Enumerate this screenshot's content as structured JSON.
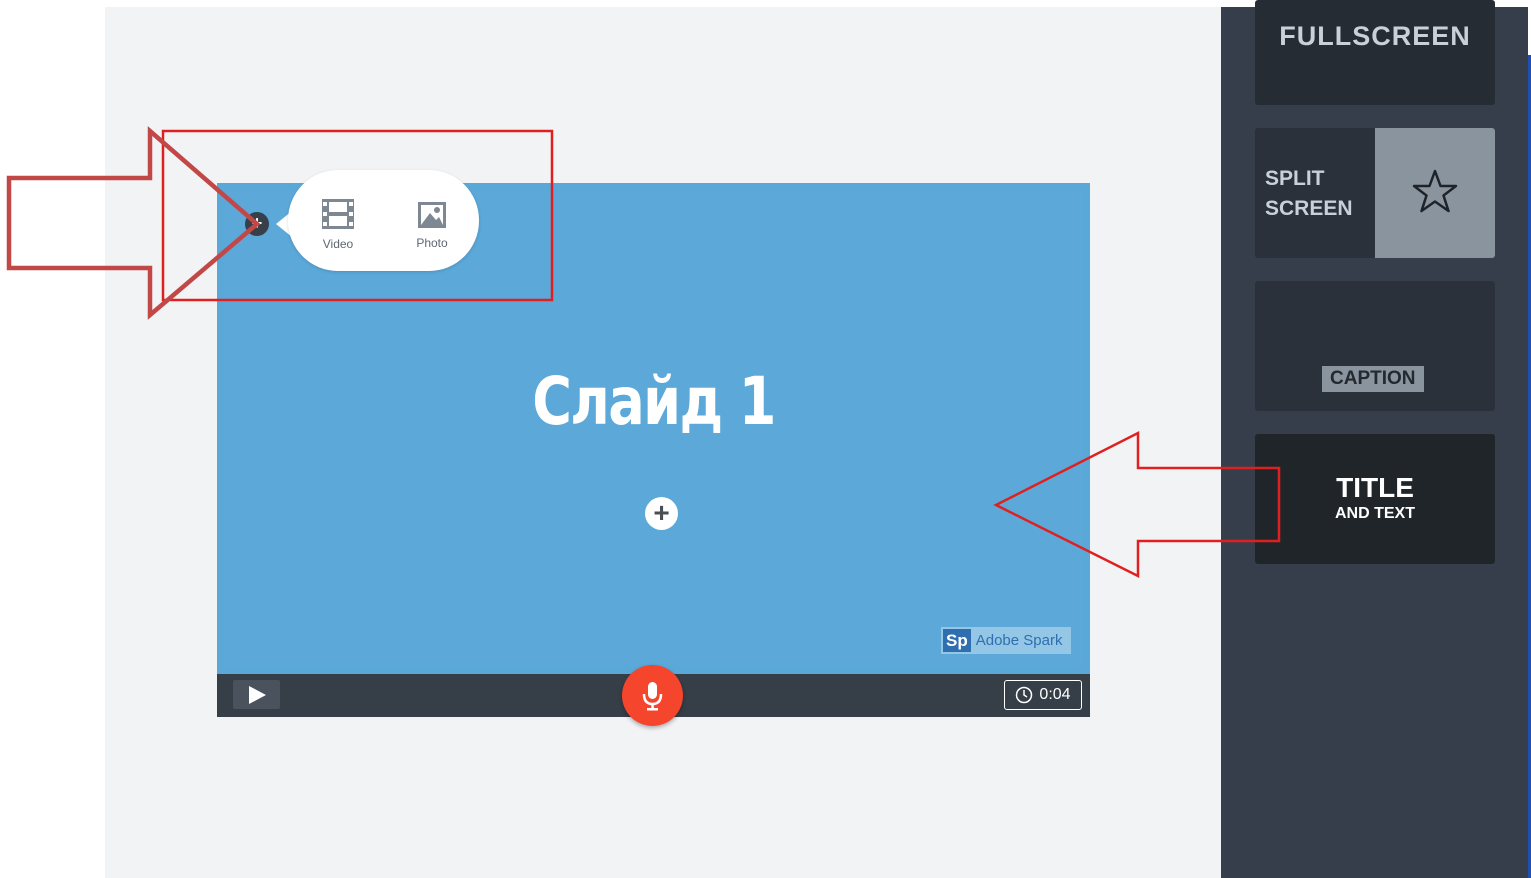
{
  "slide": {
    "title": "Слайд 1",
    "add_symbol": "+",
    "watermark": {
      "logo": "Sp",
      "text": "Adobe Spark"
    }
  },
  "media_popup": {
    "add_symbol": "+",
    "options": [
      {
        "label": "Video",
        "icon": "film-icon"
      },
      {
        "label": "Photo",
        "icon": "image-icon"
      }
    ]
  },
  "bottom_bar": {
    "play_icon": "play-icon",
    "mic_icon": "microphone-icon",
    "duration": "0:04",
    "duration_icon": "clock-icon",
    "mic_color": "#f5452c"
  },
  "layouts": {
    "fullscreen": "FULLSCREEN",
    "split_screen": [
      "SPLIT",
      "SCREEN"
    ],
    "split_icon": "star-icon",
    "caption": "CAPTION",
    "title_and_text": {
      "title": "TITLE",
      "sub": "AND TEXT"
    }
  },
  "annotation_color": "#e02020"
}
